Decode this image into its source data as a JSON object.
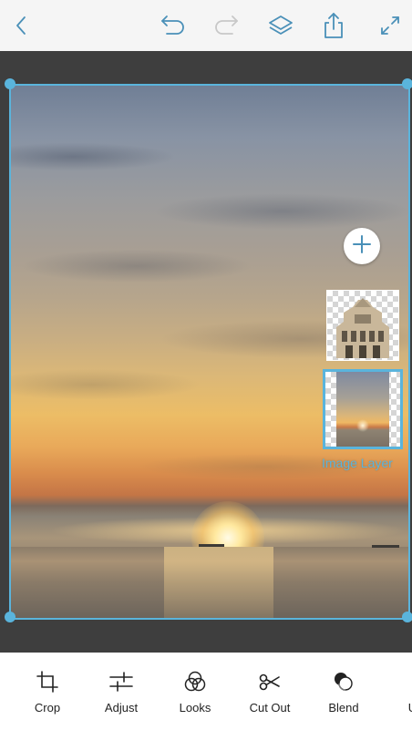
{
  "app": {
    "accent_color": "#5ab4dc",
    "toolbar_icon_color": "#4a90b8"
  },
  "top_bar": {
    "icons": [
      "back-icon",
      "undo-icon",
      "redo-icon",
      "layers-icon",
      "share-icon",
      "fullscreen-icon"
    ]
  },
  "canvas": {
    "selected": true
  },
  "layers": {
    "add_icon": "plus-icon",
    "items": [
      {
        "thumbnail": "building-cutout",
        "selected": false
      },
      {
        "thumbnail": "sunset-photo",
        "selected": true
      }
    ],
    "selected_label": "Image Layer"
  },
  "tools": [
    {
      "label": "Crop",
      "icon": "crop-icon"
    },
    {
      "label": "Adjust",
      "icon": "adjust-icon"
    },
    {
      "label": "Looks",
      "icon": "looks-icon"
    },
    {
      "label": "Cut Out",
      "icon": "scissors-icon"
    },
    {
      "label": "Blend",
      "icon": "blend-icon"
    },
    {
      "label": "Up",
      "icon": "upright-icon"
    }
  ]
}
